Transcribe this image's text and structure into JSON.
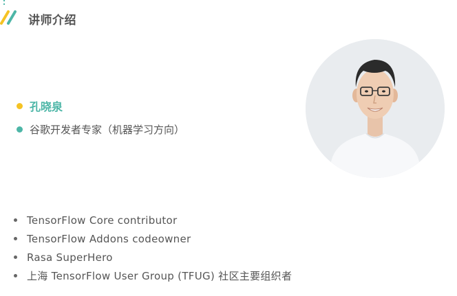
{
  "header": {
    "title": "讲师介绍",
    "icon": "double-slash-icon"
  },
  "speaker": {
    "name": "孔晓泉",
    "role": "谷歌开发者专家（机器学习方向）",
    "avatar_icon": "speaker-photo",
    "achievements": [
      "TensorFlow Core contributor",
      "TensorFlow Addons codeowner",
      "Rasa SuperHero",
      "上海 TensorFlow User Group (TFUG) 社区主要组织者"
    ]
  },
  "colors": {
    "accent_teal": "#4db6a7",
    "accent_yellow": "#f5c324",
    "text": "#555555"
  }
}
